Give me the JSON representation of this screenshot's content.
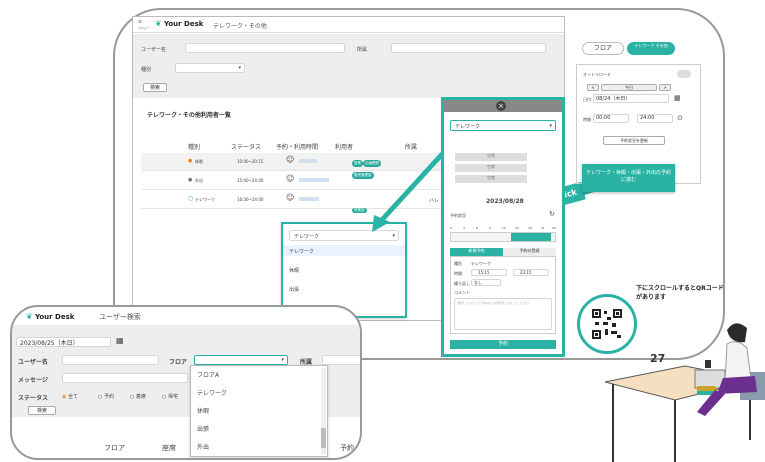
{
  "app": {
    "logo_text": "Your Desk",
    "menu_label": "メニュー"
  },
  "main": {
    "tab_title": "テレワーク・その他",
    "search": {
      "user_label": "ユーザー名",
      "dept_label": "所属",
      "type_label": "種別",
      "search_button": "検索"
    },
    "list_title": "テレワーク・その他利用者一覧",
    "columns": [
      "種別",
      "ステータス",
      "予約・利用時間",
      "利用者",
      "所属"
    ],
    "rows": [
      {
        "type": "休暇",
        "time": "10:00~20:15",
        "status_color": "#f08a24",
        "badges": [
          "営業",
          "企画開発",
          "販売管理部"
        ]
      },
      {
        "type": "外出",
        "time": "15:00~24:00",
        "status_color": "#777",
        "badges": []
      },
      {
        "type": "テレワーク",
        "time": "16:30~24:00",
        "status_color": "#2aa89a",
        "badges": [
          "営業部"
        ]
      }
    ],
    "row3_extra": "ハレ",
    "dropdown": {
      "selected": "テレワーク",
      "options": [
        "テレワーク",
        "休暇",
        "出張",
        "外出"
      ]
    }
  },
  "panel": {
    "select_value": "テレワーク",
    "slots": [
      "空席",
      "空席",
      "空席"
    ],
    "date": "2023/08/28",
    "status_label": "予約状況",
    "hours": [
      "0",
      "3",
      "6",
      "9",
      "12",
      "15",
      "18",
      "21",
      "24"
    ],
    "tabs": [
      "新規予約",
      "予約の登録"
    ],
    "form": {
      "type_label": "種別",
      "type_value": "テレワーク",
      "time_label": "時間",
      "start": "15:15",
      "end": "23:15",
      "repeat_label": "繰り返し",
      "repeat_value": "なし",
      "comment_label": "コメント",
      "comment_placeholder": "選択したいエリアやあなたの予定を入力してください"
    },
    "reserve_button": "予約"
  },
  "click_label": "click",
  "side": {
    "tab_floor": "フロア",
    "tab_telework": "テレワーク その他",
    "auto_reload": "オートリロード",
    "prev": "<",
    "today": "今日",
    "next": ">",
    "date_label": "日付",
    "date_value": "08/24（木日）",
    "time_label": "時間",
    "time_start": "00:00",
    "time_end": "24:00",
    "update_button": "予約状況を更新",
    "cta": "テレワーク・休暇・出張・外出の予約に進む"
  },
  "qr_note": "下にスクロールするとQRコードがあります",
  "cut_text": "27",
  "zoom": {
    "logo_text": "Your Desk",
    "title": "ユーザー検索",
    "date_value": "2023/08/25（木日）",
    "user_label": "ユーザー名",
    "floor_label": "フロア",
    "dept_label": "所属",
    "message_label": "メッセージ",
    "status_label": "ステータス",
    "status_options": [
      "全て",
      "予約",
      "着席",
      "帰宅"
    ],
    "search_button": "検索",
    "columns": [
      "フロア",
      "座席",
      "予約"
    ],
    "dropdown": [
      "フロアA",
      "テレワーク",
      "休暇",
      "出張",
      "外出"
    ]
  }
}
